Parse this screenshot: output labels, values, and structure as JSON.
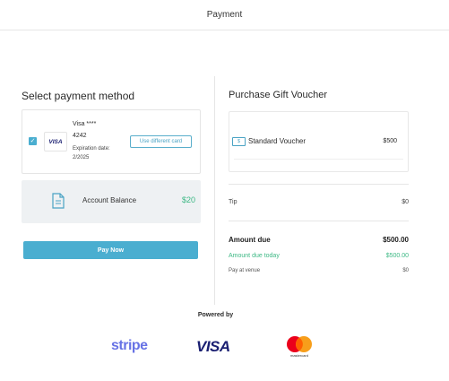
{
  "header": {
    "title": "Payment"
  },
  "payment": {
    "section_title": "Select payment method",
    "card": {
      "brand_badge": "VISA",
      "name": "Visa ****",
      "last4": "4242",
      "expiration": "Expiration date: 2/2025",
      "change_button": "Use different card",
      "selected": true
    },
    "balance": {
      "label": "Account Balance",
      "value": "$20",
      "icon": "document-icon"
    },
    "pay_button": "Pay Now"
  },
  "summary": {
    "title": "Purchase Gift Voucher",
    "voucher": {
      "icon_text": "$",
      "name": "Standard Voucher",
      "price": "$500"
    },
    "tip": {
      "label": "Tip",
      "value": "$0"
    },
    "amount_due": {
      "label": "Amount due",
      "value": "$500.00"
    },
    "amount_due_today": {
      "label": "Amount due today",
      "value": "$500.00"
    },
    "pay_at_venue": {
      "label": "Pay at venue",
      "value": "$0"
    }
  },
  "footer": {
    "powered_by": "Powered by",
    "stripe": "stripe",
    "visa": "VISA",
    "mastercard": "mastercard"
  },
  "colors": {
    "accent": "#4aaed0",
    "green": "#3cb884",
    "balance_bg": "#eef1f3"
  }
}
